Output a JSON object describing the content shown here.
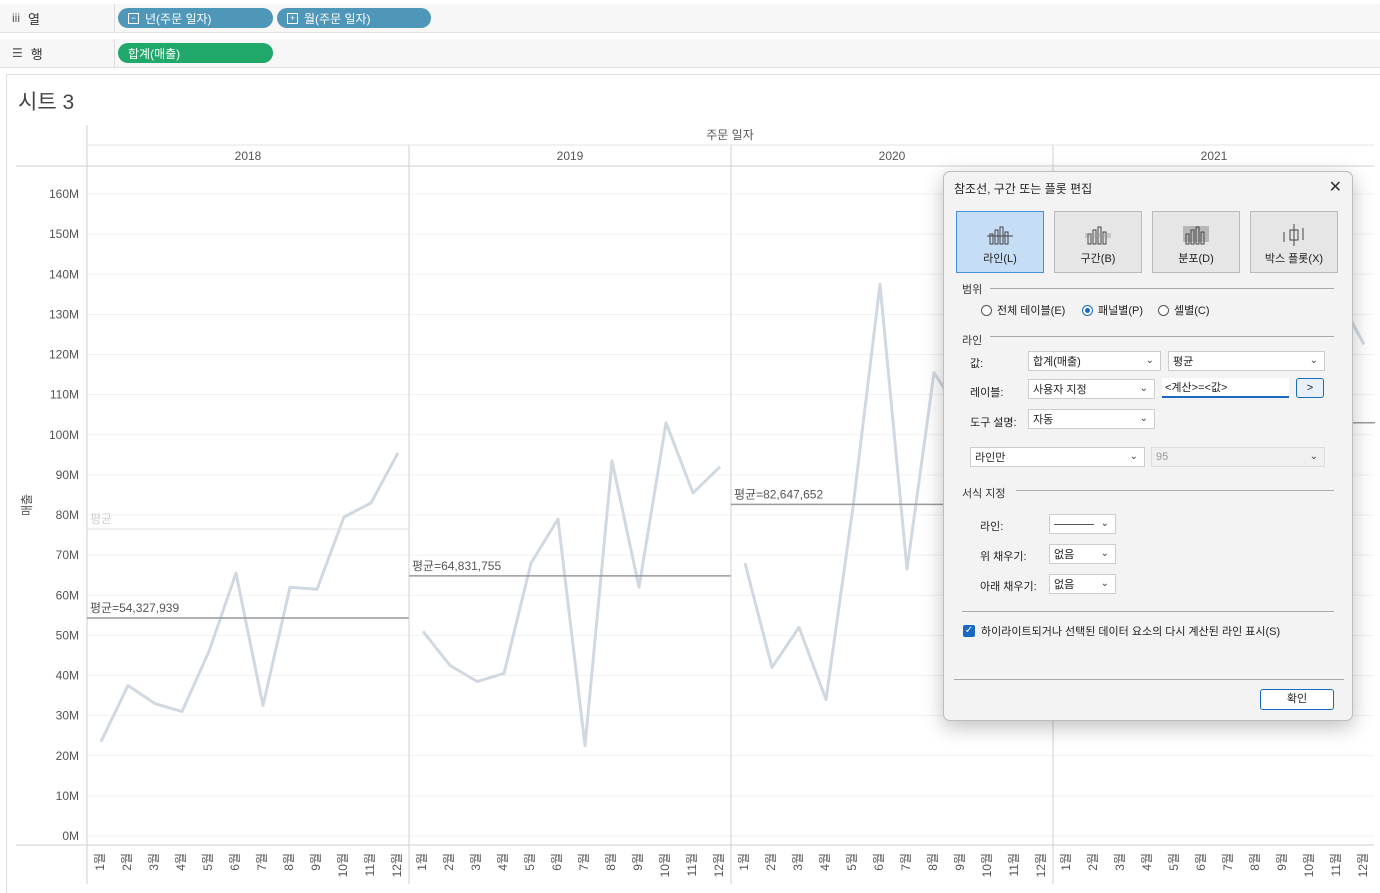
{
  "shelves": {
    "columns": {
      "label": "열",
      "pills": [
        "년(주문 일자)",
        "월(주문 일자)"
      ]
    },
    "rows": {
      "label": "행",
      "pills": [
        "합계(매출)"
      ]
    }
  },
  "sheet": {
    "title": "시트 3",
    "header": "주문 일자"
  },
  "colors": {
    "line": "#d0d9e1",
    "ref_line": "#9a9a9a",
    "pill_blue": "#4e97b8",
    "pill_green": "#1fa86a"
  },
  "chart_data": {
    "type": "line",
    "y_axis_label": "매출",
    "ylim": [
      0,
      160000000
    ],
    "y_ticks": [
      "0M",
      "10M",
      "20M",
      "30M",
      "40M",
      "50M",
      "60M",
      "70M",
      "80M",
      "90M",
      "100M",
      "110M",
      "120M",
      "130M",
      "140M",
      "150M",
      "160M"
    ],
    "x_tick_labels": [
      "1월",
      "2월",
      "3월",
      "4월",
      "5월",
      "6월",
      "7월",
      "8월",
      "9월",
      "10월",
      "11월",
      "12월"
    ],
    "panels": [
      {
        "year": "2018",
        "values": [
          23.5,
          37.5,
          33,
          31,
          46,
          65.5,
          32.5,
          62,
          61.5,
          79.5,
          83,
          95.5
        ],
        "avg_label": "평균=54,327,939",
        "avg": 54.33
      },
      {
        "year": "2019",
        "values": [
          51,
          42.5,
          38.5,
          40.5,
          68,
          79,
          22.5,
          93.5,
          62,
          103,
          85.5,
          92
        ],
        "avg_label": "평균=64,831,755",
        "avg": 64.83
      },
      {
        "year": "2020",
        "values": [
          68,
          42,
          52,
          34,
          82,
          137.5,
          66.5,
          115.5,
          105,
          null,
          null,
          null
        ],
        "avg_label": "평균=82,647,652",
        "avg": 82.65
      },
      {
        "year": "2021",
        "values": [
          null,
          null,
          null,
          null,
          null,
          null,
          null,
          null,
          null,
          null,
          135,
          122.5
        ],
        "avg_label": "",
        "avg": 103
      }
    ],
    "preview_label": "평균",
    "preview_value": 76.5
  },
  "dialog": {
    "title": "참조선, 구간 또는 플롯 편집",
    "types": [
      "라인(L)",
      "구간(B)",
      "분포(D)",
      "박스 플롯(X)"
    ],
    "scope_title": "범위",
    "scope_options": [
      "전체 테이블(E)",
      "패널별(P)",
      "셀별(C)"
    ],
    "line_title": "라인",
    "value_label": "값:",
    "value_field": "합계(매출)",
    "value_agg": "평균",
    "label_label": "레이블:",
    "label_mode": "사용자 지정",
    "label_text": "<계산>=<값>",
    "label_btn": ">",
    "tooltip_label": "도구 설명:",
    "tooltip_value": "자동",
    "line_mode": "라인만",
    "ci_value": "95",
    "format_title": "서식 지정",
    "fmt_line_label": "라인:",
    "fmt_above_label": "위 채우기:",
    "fmt_above_value": "없음",
    "fmt_below_label": "아래 채우기:",
    "fmt_below_value": "없음",
    "recalc_text": "하이라이트되거나 선택된 데이터 요소의 다시 계산된 라인 표시(S)",
    "ok": "확인"
  }
}
